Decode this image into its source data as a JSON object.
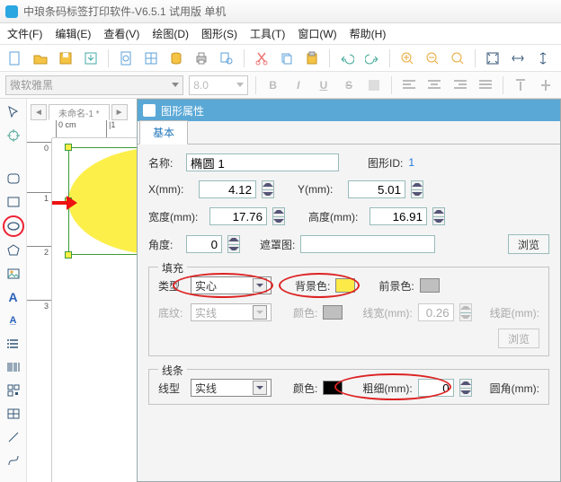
{
  "title": "中琅条码标签打印软件-V6.5.1 试用版 单机",
  "menu": [
    "文件(F)",
    "编辑(E)",
    "查看(V)",
    "绘图(D)",
    "图形(S)",
    "工具(T)",
    "窗口(W)",
    "帮助(H)"
  ],
  "font": {
    "family": "微软雅黑",
    "size": "8.0"
  },
  "btns": {
    "B": "B",
    "I": "I",
    "U": "U",
    "S": "S"
  },
  "doc_tab": "未命名-1 *",
  "panel": {
    "title": "图形属性",
    "tab": "基本",
    "name_label": "名称:",
    "name_value": "椭圆 1",
    "id_label": "图形ID:",
    "id_value": "1",
    "x_label": "X(mm):",
    "x_value": "4.12",
    "y_label": "Y(mm):",
    "y_value": "5.01",
    "w_label": "宽度(mm):",
    "w_value": "17.76",
    "h_label": "高度(mm):",
    "h_value": "16.91",
    "ang_label": "角度:",
    "ang_value": "0",
    "mask_label": "遮罩图:",
    "browse": "浏览",
    "fill": {
      "legend": "填充",
      "type_label": "类型",
      "type_value": "实心",
      "bg_label": "背景色:",
      "fg_label": "前景色:",
      "pattern_label": "底纹:",
      "pattern_value": "实线",
      "color_label": "颜色:",
      "lw_label": "线宽(mm):",
      "lw_value": "0.26",
      "ld_label": "线距(mm):"
    },
    "line": {
      "legend": "线条",
      "type_label": "线型",
      "type_value": "实线",
      "color_label": "颜色:",
      "weight_label": "粗细(mm):",
      "weight_value": "0",
      "radius_label": "圆角(mm):"
    }
  },
  "ruler": {
    "h": [
      "0 cm",
      "|1"
    ],
    "v": [
      "0",
      "1",
      "2",
      "3"
    ]
  }
}
